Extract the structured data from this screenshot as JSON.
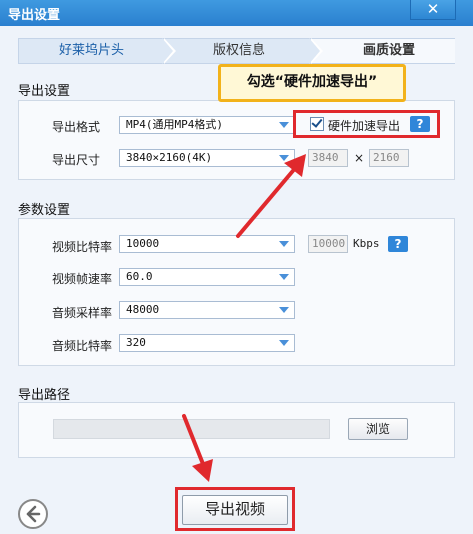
{
  "window": {
    "title": "导出设置",
    "close_label": "✕"
  },
  "steps": [
    {
      "label": "好莱坞片头"
    },
    {
      "label": "版权信息"
    },
    {
      "label": "画质设置"
    }
  ],
  "callout": {
    "text": "勾选“硬件加速导出”"
  },
  "export_settings": {
    "title": "导出设置",
    "format_label": "导出格式",
    "format_value": "MP4(通用MP4格式)",
    "hw_accel_label": "硬件加速导出",
    "hw_accel_checked": true,
    "size_label": "导出尺寸",
    "size_value": "3840×2160(4K)",
    "width": "3840",
    "times": "×",
    "height": "2160"
  },
  "params": {
    "title": "参数设置",
    "video_bitrate_label": "视频比特率",
    "video_bitrate_value": "10000",
    "video_bitrate_box": "10000",
    "bitrate_unit": "Kbps",
    "framerate_label": "视频帧速率",
    "framerate_value": "60.0",
    "audio_samplerate_label": "音频采样率",
    "audio_samplerate_value": "48000",
    "audio_bitrate_label": "音频比特率",
    "audio_bitrate_value": "320"
  },
  "output": {
    "title": "导出路径",
    "path_value": "",
    "browse_label": "浏览"
  },
  "footer": {
    "export_label": "导出视频",
    "back_icon": "arrow-left-icon"
  },
  "help_label": "?",
  "colors": {
    "accent": "#2f86d9",
    "highlight": "#e0292d",
    "callout_border": "#f2b21a"
  }
}
